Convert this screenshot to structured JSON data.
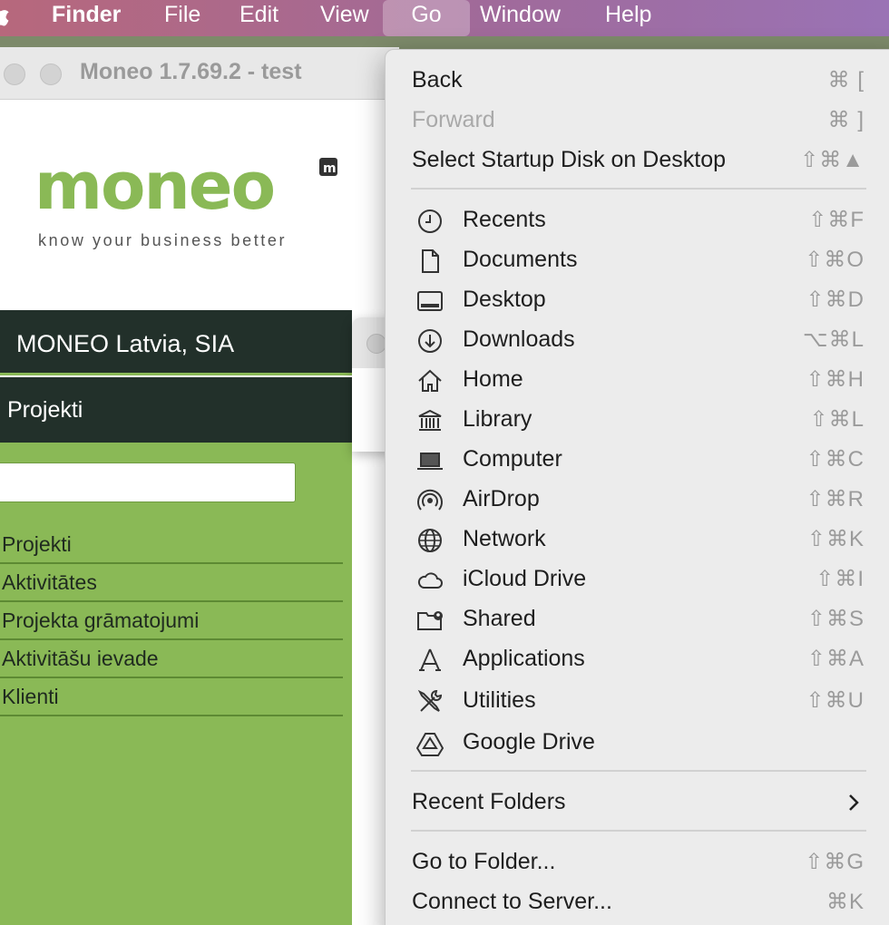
{
  "menubar": {
    "items": [
      "Finder",
      "File",
      "Edit",
      "View",
      "Go",
      "Window",
      "Help"
    ]
  },
  "moneo_window": {
    "title": "Moneo 1.7.69.2 - test",
    "logo_text": "moneo",
    "logo_badge": "m",
    "tagline": "know your business better",
    "company": "MONEO Latvia, SIA",
    "section": "Projekti",
    "nav": [
      "Projekti",
      "Aktivitātes",
      "Projekta grāmatojumi",
      "Aktivitāšu ievade",
      "Klienti"
    ]
  },
  "go_menu": {
    "top": [
      {
        "label": "Back",
        "shortcut": "⌘ [",
        "enabled": true
      },
      {
        "label": "Forward",
        "shortcut": "⌘ ]",
        "enabled": false
      },
      {
        "label": "Select Startup Disk on Desktop",
        "shortcut": "⇧⌘▲",
        "enabled": true
      }
    ],
    "places": [
      {
        "label": "Recents",
        "shortcut": "⇧⌘F",
        "icon": "clock-icon"
      },
      {
        "label": "Documents",
        "shortcut": "⇧⌘O",
        "icon": "document-icon"
      },
      {
        "label": "Desktop",
        "shortcut": "⇧⌘D",
        "icon": "desktop-icon"
      },
      {
        "label": "Downloads",
        "shortcut": "⌥⌘L",
        "icon": "download-icon"
      },
      {
        "label": "Home",
        "shortcut": "⇧⌘H",
        "icon": "home-icon"
      },
      {
        "label": "Library",
        "shortcut": "⇧⌘L",
        "icon": "library-icon"
      },
      {
        "label": "Computer",
        "shortcut": "⇧⌘C",
        "icon": "laptop-icon"
      },
      {
        "label": "AirDrop",
        "shortcut": "⇧⌘R",
        "icon": "airdrop-icon"
      },
      {
        "label": "Network",
        "shortcut": "⇧⌘K",
        "icon": "globe-icon"
      },
      {
        "label": "iCloud Drive",
        "shortcut": "⇧⌘I",
        "icon": "cloud-icon"
      },
      {
        "label": "Shared",
        "shortcut": "⇧⌘S",
        "icon": "shared-folder-icon"
      },
      {
        "label": "Applications",
        "shortcut": "⇧⌘A",
        "icon": "applications-icon"
      },
      {
        "label": "Utilities",
        "shortcut": "⇧⌘U",
        "icon": "tools-icon"
      },
      {
        "label": "Google Drive",
        "shortcut": "",
        "icon": "google-drive-icon"
      }
    ],
    "recent_folders": "Recent Folders",
    "bottom": [
      {
        "label": "Go to Folder...",
        "shortcut": "⇧⌘G"
      },
      {
        "label": "Connect to Server...",
        "shortcut": "⌘K"
      }
    ]
  },
  "colors": {
    "moneo_green": "#8ab956",
    "moneo_dark": "#22302a",
    "menu_bg": "#ececec"
  }
}
